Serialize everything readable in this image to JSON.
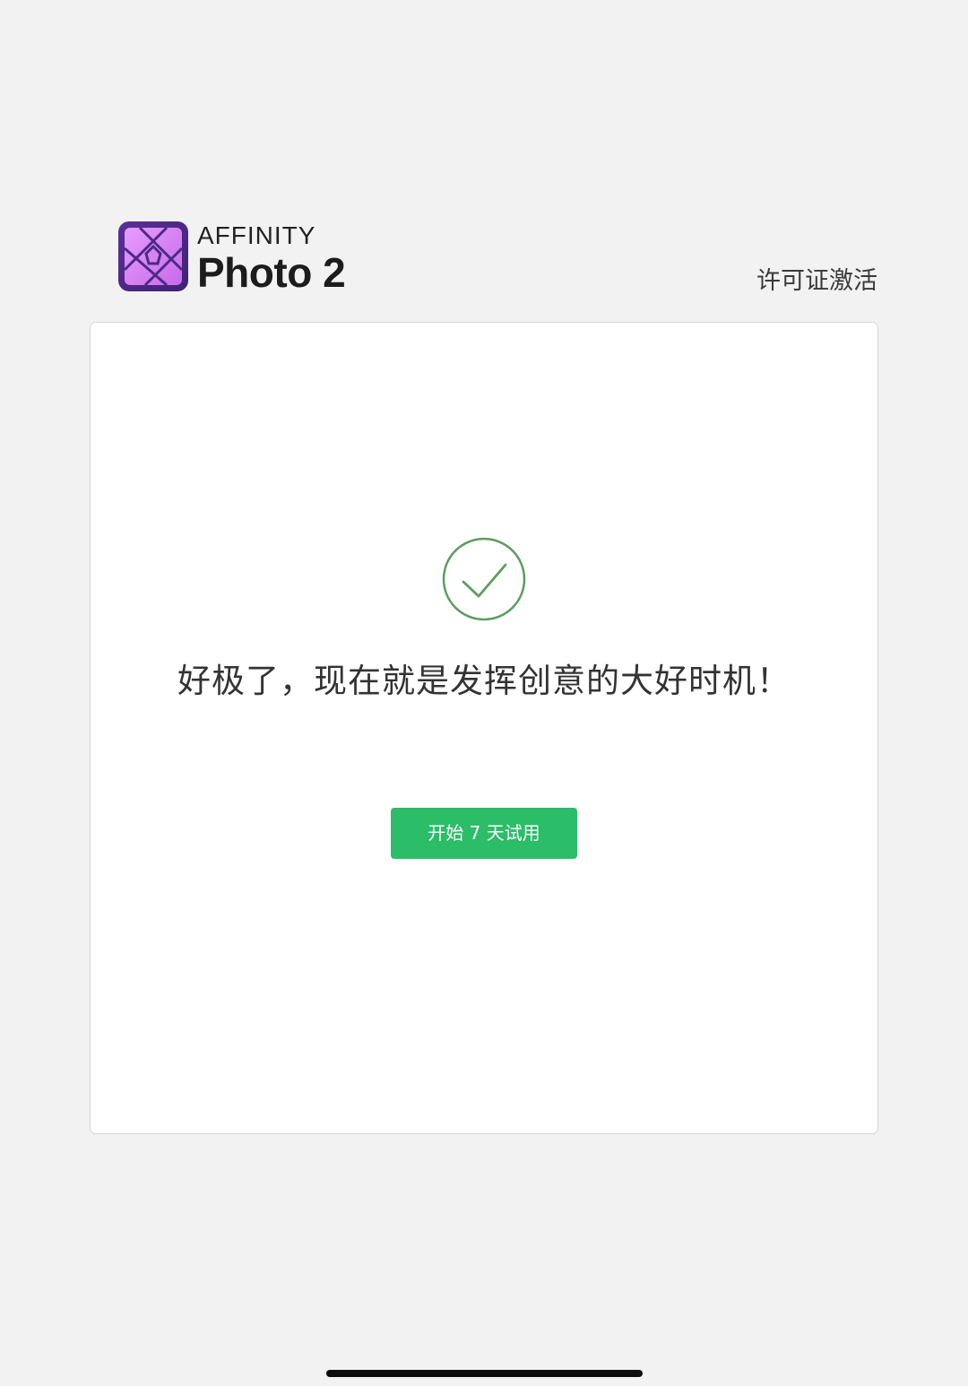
{
  "header": {
    "brand_small": "AFFINITY",
    "brand_big": "Photo 2",
    "license_link": "许可证激活"
  },
  "card": {
    "message": "好极了，现在就是发挥创意的大好时机！",
    "trial_button": "开始 7 天试用"
  },
  "colors": {
    "background": "#f2f2f2",
    "card": "#ffffff",
    "accent_green": "#2bbd68",
    "check_green": "#5d9d60",
    "logo_purple_dark": "#4b2a86",
    "logo_purple_light": "#d580f0"
  },
  "icons": {
    "logo": "affinity-photo-logo-icon",
    "check": "check-circle-icon"
  }
}
